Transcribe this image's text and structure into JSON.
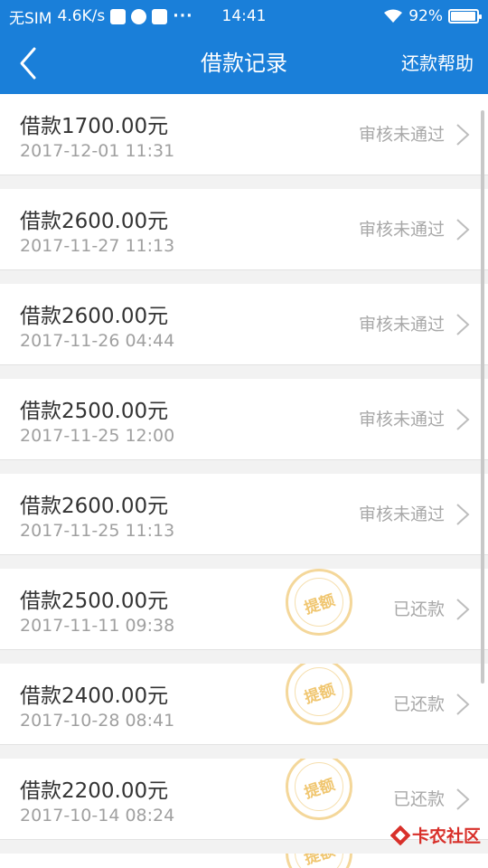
{
  "status_bar": {
    "carrier": "无SIM",
    "speed": "4.6K/s",
    "dots": "···",
    "time": "14:41",
    "battery": "92%"
  },
  "navbar": {
    "title": "借款记录",
    "help": "还款帮助"
  },
  "records": [
    {
      "amount": "借款1700.00元",
      "date": "2017-12-01 11:31",
      "status": "审核未通过"
    },
    {
      "amount": "借款2600.00元",
      "date": "2017-11-27 11:13",
      "status": "审核未通过"
    },
    {
      "amount": "借款2600.00元",
      "date": "2017-11-26 04:44",
      "status": "审核未通过"
    },
    {
      "amount": "借款2500.00元",
      "date": "2017-11-25 12:00",
      "status": "审核未通过"
    },
    {
      "amount": "借款2600.00元",
      "date": "2017-11-25 11:13",
      "status": "审核未通过"
    },
    {
      "amount": "借款2500.00元",
      "date": "2017-11-11 09:38",
      "status": "已还款",
      "stamp": "提额"
    },
    {
      "amount": "借款2400.00元",
      "date": "2017-10-28 08:41",
      "status": "已还款",
      "stamp": "提额"
    },
    {
      "amount": "借款2200.00元",
      "date": "2017-10-14 08:24",
      "status": "已还款",
      "stamp": "提额"
    }
  ],
  "partial_stamp": "提额",
  "watermark": "卡农社区",
  "colors": {
    "primary": "#1a7fd9",
    "stamp": "#f0c670",
    "watermark": "#d8302a"
  }
}
